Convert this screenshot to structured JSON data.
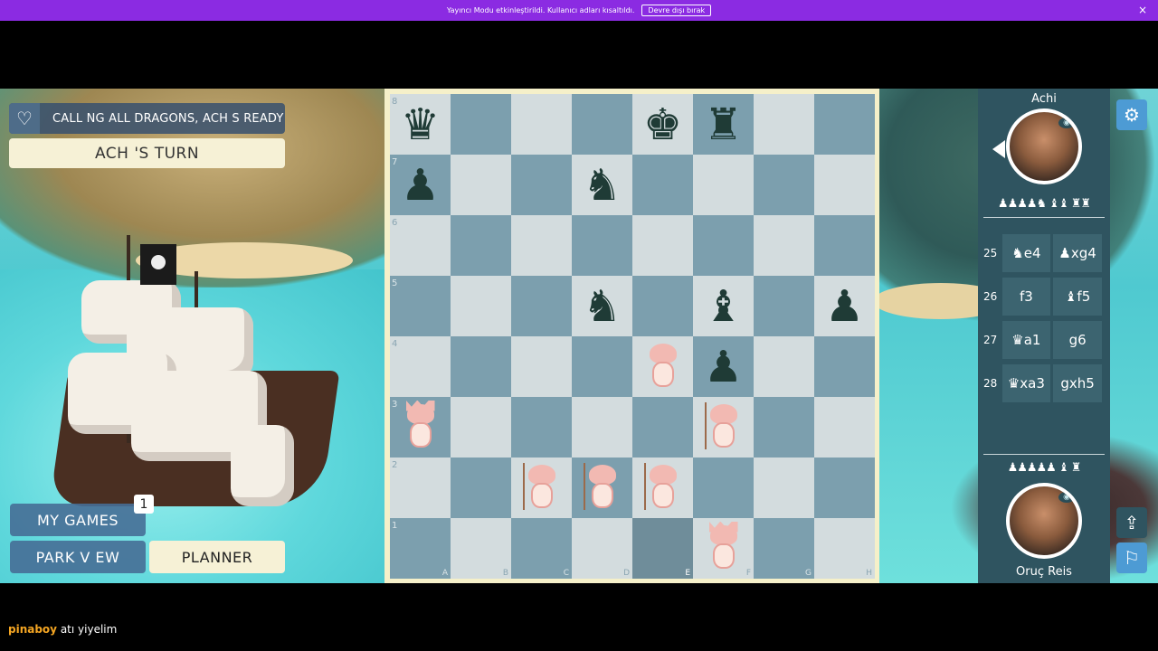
{
  "banner": {
    "message": "Yayıncı Modu etkinleştirildi. Kullanıcı adları kısaltıldı.",
    "button_label": "Devre dışı bırak",
    "close_glyph": "×"
  },
  "hud": {
    "heart_icon": "♡",
    "status_text": "CALL NG ALL DRAGONS, ACH  S READY",
    "turn_text": "ACH 'S TURN",
    "my_games_label": "MY GAMES",
    "my_games_badge": "1",
    "park_view_label": "PARK V EW",
    "planner_label": "PLANNER"
  },
  "board": {
    "ranks": [
      "8",
      "7",
      "6",
      "5",
      "4",
      "3",
      "2",
      "1"
    ],
    "files": [
      "A",
      "B",
      "C",
      "D",
      "E",
      "F",
      "G",
      "H"
    ],
    "highlight_square": "e1",
    "dark_pieces": [
      {
        "square": "a8",
        "glyph": "♛"
      },
      {
        "square": "e8",
        "glyph": "♚"
      },
      {
        "square": "f8",
        "glyph": "♜"
      },
      {
        "square": "a7",
        "glyph": "♟"
      },
      {
        "square": "d7",
        "glyph": "♞"
      },
      {
        "square": "d5",
        "glyph": "♞"
      },
      {
        "square": "f5",
        "glyph": "♝"
      },
      {
        "square": "h5",
        "glyph": "♟"
      },
      {
        "square": "f4",
        "glyph": "♟"
      }
    ],
    "light_pieces": [
      {
        "square": "e4",
        "kind": "knight"
      },
      {
        "square": "a3",
        "kind": "queen"
      },
      {
        "square": "f3",
        "kind": "pawn"
      },
      {
        "square": "c2",
        "kind": "pawn"
      },
      {
        "square": "d2",
        "kind": "pawn"
      },
      {
        "square": "e2",
        "kind": "pawn"
      },
      {
        "square": "f1",
        "kind": "king"
      }
    ]
  },
  "players": {
    "top": {
      "name": "Achi",
      "captured": "♟♟♟♟♞ ♝♝ ♜♜"
    },
    "bottom": {
      "name": "Oruç Reis",
      "captured": "♟♟♟♟♟ ♝ ♜"
    }
  },
  "moves": [
    {
      "num": "25",
      "white": "♞e4",
      "black": "♟xg4"
    },
    {
      "num": "26",
      "white": "f3",
      "black": "♝f5"
    },
    {
      "num": "27",
      "white": "♛a1",
      "black": "g6"
    },
    {
      "num": "28",
      "white": "♛xa3",
      "black": "gxh5"
    }
  ],
  "icons": {
    "settings": "⚙",
    "share": "⇪",
    "flag": "⚐",
    "eye": "◉"
  },
  "chat": {
    "user": "pinaboy",
    "message": "atı yiyelim"
  },
  "colors": {
    "banner": "#8b2be2",
    "board_light": "#d3dcde",
    "board_dark": "#7c9fae",
    "board_frame": "#f5f0c9",
    "panel": "#2f5460",
    "dark_piece": "#1f3b36",
    "light_piece": "#f2b9b2"
  }
}
